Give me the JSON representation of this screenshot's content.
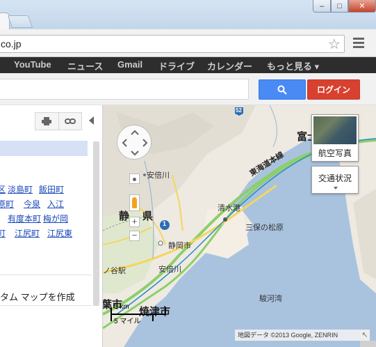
{
  "browser": {
    "address": "co.jp",
    "window_controls": [
      "min-icon",
      "max-icon",
      "close-icon"
    ]
  },
  "gbar": {
    "items": [
      "YouTube",
      "ニュース",
      "Gmail",
      "ドライブ",
      "カレンダー",
      "もっと見る ▾"
    ]
  },
  "search": {
    "button_icon": "search-icon",
    "login_label": "ログイン"
  },
  "panel": {
    "links_row1": [
      "区",
      "淡島町",
      "飯田町"
    ],
    "links_row2": [
      "原町",
      "今泉",
      "入江"
    ],
    "links_row3": [
      "有度本町",
      "梅が岡"
    ],
    "links_row4": [
      "町",
      "江尻町",
      "江尻東"
    ],
    "custom_map_text": "タム マップを作成"
  },
  "map": {
    "labels": {
      "pref": "静岡県",
      "pref_short_left": "静",
      "pref_short_right": "県",
      "fuji": "富士",
      "abekawa": "安倍川",
      "abekawa2": "安倍川",
      "shimizu": "清水港",
      "miho": "三保の松原",
      "shizuoka_station": "静岡市",
      "abekawa_town": "ノ谷駅",
      "suruga_bay": "駿河湾",
      "tokaido": "東海道本線",
      "city_left": "葉市",
      "yaizu": "焼津市",
      "route1": "1",
      "route52": "52"
    },
    "aerial_label": "航空写真",
    "traffic_label": "交通状況",
    "scale_km": "5 km",
    "scale_mile": "5 マイル",
    "copyright": "地図データ ©2013 Google, ZENRIN"
  }
}
